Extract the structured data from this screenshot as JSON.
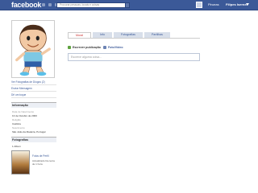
{
  "topbar": {
    "logo": "facebook",
    "search_placeholder": "Procurar pessoas, locais e coisas",
    "home_label": "Pirueas",
    "profile_label": "Filipes Isernel"
  },
  "sidebar": {
    "links": [
      "Ver Fotografias de Diogos (2)",
      "Enviar Mensagem",
      "Dê um toque"
    ],
    "info_title": "Informação",
    "info": [
      {
        "label": "Data de Nascimento",
        "value": "13 de Outubro de 2000"
      },
      {
        "label": "Religião",
        "value": "Católica"
      },
      {
        "label": "Nascimento",
        "value": "São João da Madeira, Portugal"
      }
    ],
    "photos_title": "Fotografias",
    "album_count": "1 Album",
    "album_title": "Fotos de Perfil",
    "album_note": "Actualizado há cerca de 1 hora"
  },
  "tabs": [
    {
      "label": "Mural",
      "active": true
    },
    {
      "label": "Info",
      "active": false
    },
    {
      "label": "Fotografias",
      "active": false
    },
    {
      "label": "Partilhas",
      "active": false
    }
  ],
  "composer": {
    "post_label": "Escrever publicação",
    "photo_label": "Foto/Vídeo",
    "placeholder": "Escreve alguma coisa..."
  },
  "colors": {
    "brand": "#3b5998",
    "tab_bg": "#d8dfea",
    "active_tab_text": "#cc3333"
  }
}
